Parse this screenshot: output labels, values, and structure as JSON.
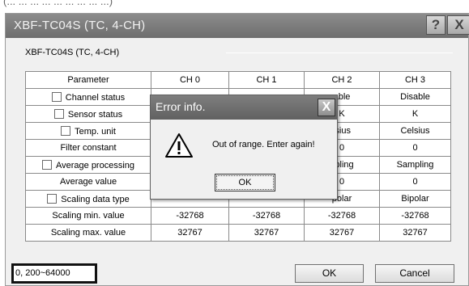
{
  "top_strip_text": "(... ... ... ... ... ... ... ... ...)",
  "window": {
    "title": "XBF-TC04S (TC, 4-CH)",
    "help_button": "?",
    "close_button": "X"
  },
  "group_label": "XBF-TC04S (TC, 4-CH)",
  "table": {
    "headers": [
      "Parameter",
      "CH 0",
      "CH 1",
      "CH 2",
      "CH 3"
    ],
    "rows": [
      {
        "label": "Channel status",
        "checkbox": true,
        "values": [
          "",
          "",
          "able",
          "Disable"
        ]
      },
      {
        "label": "Sensor status",
        "checkbox": true,
        "values": [
          "",
          "",
          "K",
          "K"
        ]
      },
      {
        "label": "Temp. unit",
        "checkbox": true,
        "values": [
          "",
          "",
          "lsius",
          "Celsius"
        ]
      },
      {
        "label": "Filter constant",
        "checkbox": false,
        "values": [
          "",
          "",
          "0",
          "0"
        ]
      },
      {
        "label": "Average processing",
        "checkbox": true,
        "values": [
          "",
          "",
          "npling",
          "Sampling"
        ]
      },
      {
        "label": "Average value",
        "checkbox": false,
        "values": [
          "",
          "",
          "0",
          "0"
        ]
      },
      {
        "label": "Scaling data type",
        "checkbox": true,
        "values": [
          "",
          "",
          "polar",
          "Bipolar"
        ]
      },
      {
        "label": "Scaling min. value",
        "checkbox": false,
        "values": [
          "-32768",
          "-32768",
          "-32768",
          "-32768"
        ]
      },
      {
        "label": "Scaling max. value",
        "checkbox": false,
        "values": [
          "32767",
          "32767",
          "32767",
          "32767"
        ]
      }
    ]
  },
  "error_dialog": {
    "title": "Error info.",
    "close_label": "X",
    "icon": "warning-icon",
    "message": "Out of range. Enter again!",
    "ok_label": "OK"
  },
  "status_range": "0, 200~64000",
  "footer": {
    "ok_label": "OK",
    "cancel_label": "Cancel"
  }
}
